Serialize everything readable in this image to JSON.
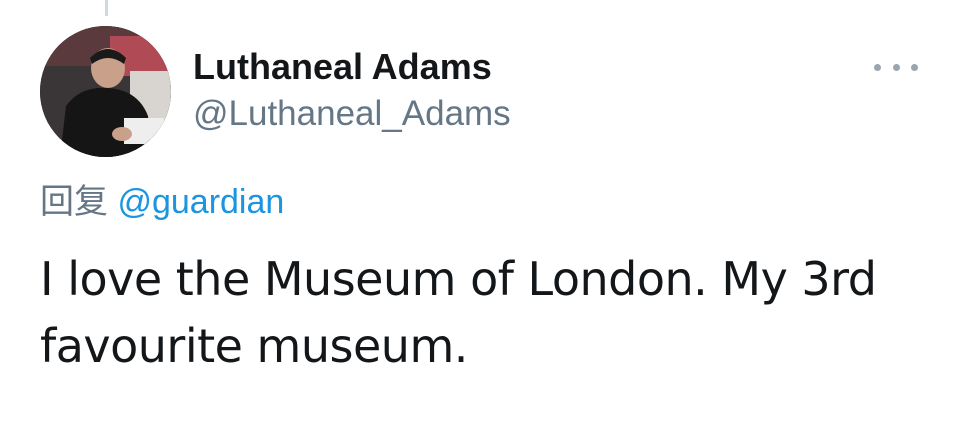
{
  "tweet": {
    "author": {
      "name": "Luthaneal Adams",
      "handle": "@Luthaneal_Adams",
      "avatar_icon": "profile-photo"
    },
    "more_icon": "more-options-icon",
    "reply": {
      "prefix": "回复",
      "mention": "@guardian"
    },
    "text_line1": "I love the Museum of London. My 3rd",
    "text_line2": "favourite museum."
  },
  "colors": {
    "text": "#14171a",
    "secondary": "#657786",
    "link": "#1b95e0"
  }
}
